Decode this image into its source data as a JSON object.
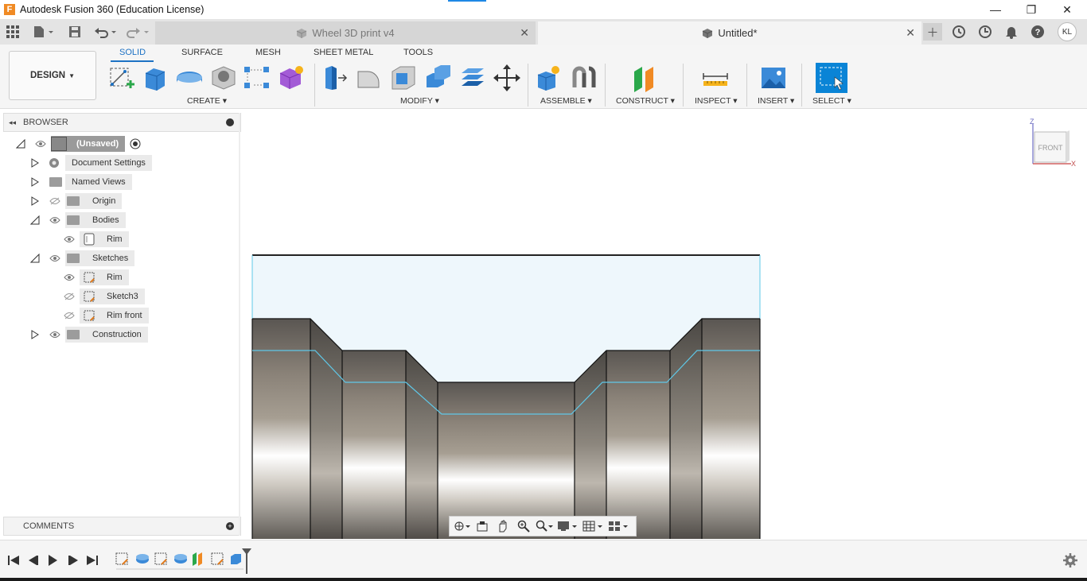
{
  "window": {
    "title": "Autodesk Fusion 360 (Education License)",
    "minimize": "—",
    "maximize": "❐",
    "close": "✕"
  },
  "tabs": [
    {
      "label": "Wheel 3D print v4",
      "active": false
    },
    {
      "label": "Untitled*",
      "active": true
    }
  ],
  "user": {
    "initials": "KL"
  },
  "toolbar": {
    "workspace": "DESIGN",
    "workspace_tabs": [
      "SOLID",
      "SURFACE",
      "MESH",
      "SHEET METAL",
      "TOOLS"
    ],
    "groups": {
      "create": "CREATE",
      "modify": "MODIFY",
      "assemble": "ASSEMBLE",
      "construct": "CONSTRUCT",
      "inspect": "INSPECT",
      "insert": "INSERT",
      "select": "SELECT"
    }
  },
  "browser": {
    "title": "BROWSER",
    "root": "(Unsaved)",
    "items": [
      {
        "label": "Document Settings"
      },
      {
        "label": "Named Views"
      },
      {
        "label": "Origin"
      },
      {
        "label": "Bodies"
      },
      {
        "label": "Rim"
      },
      {
        "label": "Sketches"
      },
      {
        "label": "Rim"
      },
      {
        "label": "Sketch3"
      },
      {
        "label": "Rim front"
      },
      {
        "label": "Construction"
      }
    ]
  },
  "comments": {
    "title": "COMMENTS"
  },
  "viewcube": {
    "face": "FRONT",
    "axis_z": "Z",
    "axis_x": "X"
  },
  "colors": {
    "accent": "#1d72c4",
    "select_blue": "#0a84d6",
    "profile_edge": "#5fc8e8"
  }
}
